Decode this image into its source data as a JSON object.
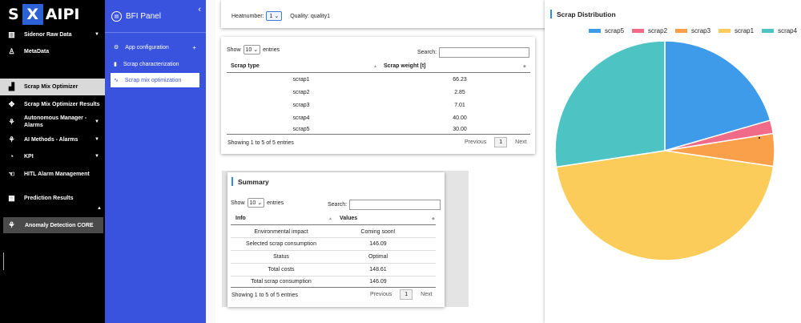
{
  "brand": {
    "left": "S",
    "mark": "X",
    "right": "AIPI"
  },
  "nav": {
    "items": [
      {
        "label": "Sidenor Raw Data",
        "icon": "chart-icon",
        "caret": true
      },
      {
        "label": "MetaData",
        "icon": "person-icon",
        "caret": false
      },
      {
        "label": "Scrap Mix Optimizer",
        "icon": "factory-icon",
        "caret": false,
        "active": true
      },
      {
        "label": "Scrap Mix Optimizer Results",
        "icon": "arrows-icon",
        "caret": false
      },
      {
        "label": "Autonomous Manager - Alarms",
        "icon": "sitemap-icon",
        "caret": true
      },
      {
        "label": "AI Methods - Alarms",
        "icon": "sitemap-icon",
        "caret": true
      },
      {
        "label": "KPI",
        "icon": "gauge-icon",
        "caret": true
      },
      {
        "label": "HITL Alarm Management",
        "icon": "hand-icon",
        "caret": false
      },
      {
        "label": "Prediction Results",
        "icon": "table-icon",
        "caret": false
      }
    ],
    "anomaly": "Anomaly Detection CORE"
  },
  "panel": {
    "title": "BFI Panel",
    "items": [
      {
        "label": "App configuration",
        "icon": "gear-icon",
        "plus": "+"
      },
      {
        "label": "Scrap characterization",
        "icon": "bar-chart-icon"
      },
      {
        "label": "Scrap mix optimization",
        "icon": "wave-icon",
        "active": true
      }
    ]
  },
  "heat": {
    "heatnumber_label": "Heatnumber:",
    "heatnumber_value": "1",
    "quality_label": "Quality:",
    "quality_value": "quality1"
  },
  "scrap_table": {
    "show": "Show",
    "entries_value": "10",
    "entries": "entries",
    "search": "Search:",
    "headers": [
      "Scrap type",
      "Scrap weight [t]"
    ],
    "rows": [
      [
        "scrap1",
        "66.23"
      ],
      [
        "scrap2",
        "2.85"
      ],
      [
        "scrap3",
        "7.01"
      ],
      [
        "scrap4",
        "40.00"
      ],
      [
        "scrap5",
        "30.00"
      ]
    ],
    "info": "Showing 1 to 5 of 5 entries",
    "prev": "Previous",
    "page": "1",
    "next": "Next"
  },
  "summary": {
    "title": "Summary",
    "show": "Show",
    "entries_value": "10",
    "entries": "entries",
    "search": "Search:",
    "headers": [
      "Info",
      "Values"
    ],
    "rows": [
      [
        "Environmental impact",
        "Coming soon!"
      ],
      [
        "Selected scrap consumption",
        "146.09"
      ],
      [
        "Status",
        "Optimal"
      ],
      [
        "Total costs",
        "148.61"
      ],
      [
        "Total scrap consumption",
        "146.09"
      ]
    ],
    "info": "Showing 1 to 5 of 5 entries",
    "prev": "Previous",
    "page": "1",
    "next": "Next"
  },
  "chart_title": "Scrap Distribution",
  "chart_data": {
    "type": "pie",
    "title": "Scrap Distribution",
    "legend_position": "top",
    "series": [
      {
        "name": "scrap5",
        "value": 30.0,
        "color": "#3d9be9"
      },
      {
        "name": "scrap2",
        "value": 2.85,
        "color": "#f06b87"
      },
      {
        "name": "scrap3",
        "value": 7.01,
        "color": "#fba04a"
      },
      {
        "name": "scrap1",
        "value": 66.23,
        "color": "#fccc5a"
      },
      {
        "name": "scrap4",
        "value": 40.0,
        "color": "#4dc4c3"
      }
    ]
  }
}
